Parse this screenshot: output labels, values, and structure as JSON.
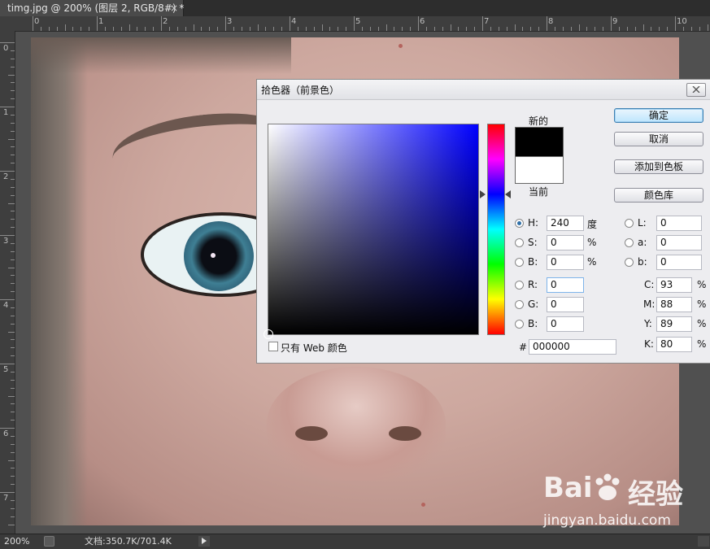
{
  "document": {
    "tab_title": "timg.jpg @ 200% (图层 2, RGB/8#) *",
    "close_glyph": "×"
  },
  "ruler": {
    "top_labels": [
      "0",
      "1",
      "2",
      "3",
      "4",
      "5",
      "6",
      "7",
      "8",
      "9",
      "10"
    ],
    "left_labels": [
      "0",
      "1",
      "2",
      "3",
      "4",
      "5",
      "6",
      "7"
    ]
  },
  "watermark": {
    "brand_left": "Bai",
    "brand_right": "经验",
    "url": "jingyan.baidu.com"
  },
  "status": {
    "zoom": "200%",
    "doc_info": "文档:350.7K/701.4K"
  },
  "dialog": {
    "title": "拾色器（前景色）",
    "new_label": "新的",
    "current_label": "当前",
    "ok_label": "确定",
    "cancel_label": "取消",
    "add_swatch_label": "添加到色板",
    "color_library_label": "颜色库",
    "web_only_label": "只有 Web 颜色",
    "new_color": "#000000",
    "current_color": "#ffffff",
    "hsb": {
      "h_label": "H:",
      "h_value": "240",
      "h_unit": "度",
      "s_label": "S:",
      "s_value": "0",
      "s_unit": "%",
      "b_label": "B:",
      "b_value": "0",
      "b_unit": "%"
    },
    "rgb": {
      "r_label": "R:",
      "r_value": "0",
      "g_label": "G:",
      "g_value": "0",
      "b_label": "B:",
      "b_value": "0"
    },
    "lab": {
      "l_label": "L:",
      "l_value": "0",
      "a_label": "a:",
      "a_value": "0",
      "b_label": "b:",
      "b_value": "0"
    },
    "cmyk": {
      "c_label": "C:",
      "c_value": "93",
      "m_label": "M:",
      "m_value": "88",
      "y_label": "Y:",
      "y_value": "89",
      "k_label": "K:",
      "k_value": "80",
      "unit": "%"
    },
    "hex_label": "#",
    "hex_value": "000000",
    "selected_mode": "H"
  }
}
